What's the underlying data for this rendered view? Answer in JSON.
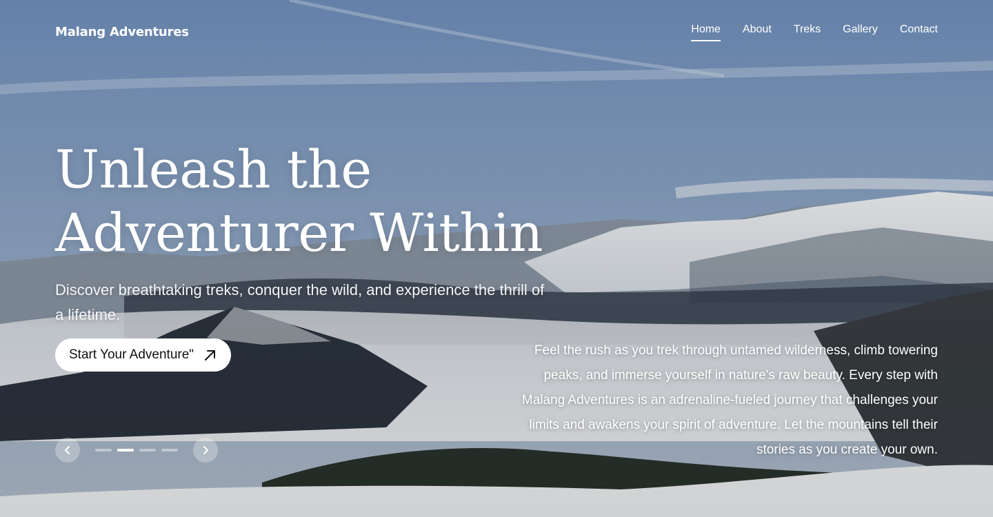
{
  "brand": {
    "name": "Malang Adventures"
  },
  "nav": {
    "items": [
      {
        "label": "Home",
        "active": true
      },
      {
        "label": "About",
        "active": false
      },
      {
        "label": "Treks",
        "active": false
      },
      {
        "label": "Gallery",
        "active": false
      },
      {
        "label": "Contact",
        "active": false
      }
    ]
  },
  "hero": {
    "headline_line1": "Unleash the",
    "headline_line2": "Adventurer Within",
    "subheading": "Discover breathtaking treks, conquer the wild, and experience the thrill of a lifetime.",
    "cta_label": "Start Your Adventure\"",
    "cta_icon": "arrow-up-right-icon",
    "description": "Feel the rush as you trek through untamed wilderness, climb towering peaks, and immerse yourself in nature's raw beauty. Every step with Malang Adventures is an adrenaline-fueled journey that challenges your limits and awakens your spirit of adventure. Let the mountains tell their stories as you create your own."
  },
  "slider": {
    "prev_icon": "chevron-left-icon",
    "next_icon": "chevron-right-icon",
    "slide_count": 4,
    "active_slide": 2
  },
  "colors": {
    "text": "#ffffff",
    "cta_bg": "#ffffff",
    "cta_text": "#111111"
  }
}
